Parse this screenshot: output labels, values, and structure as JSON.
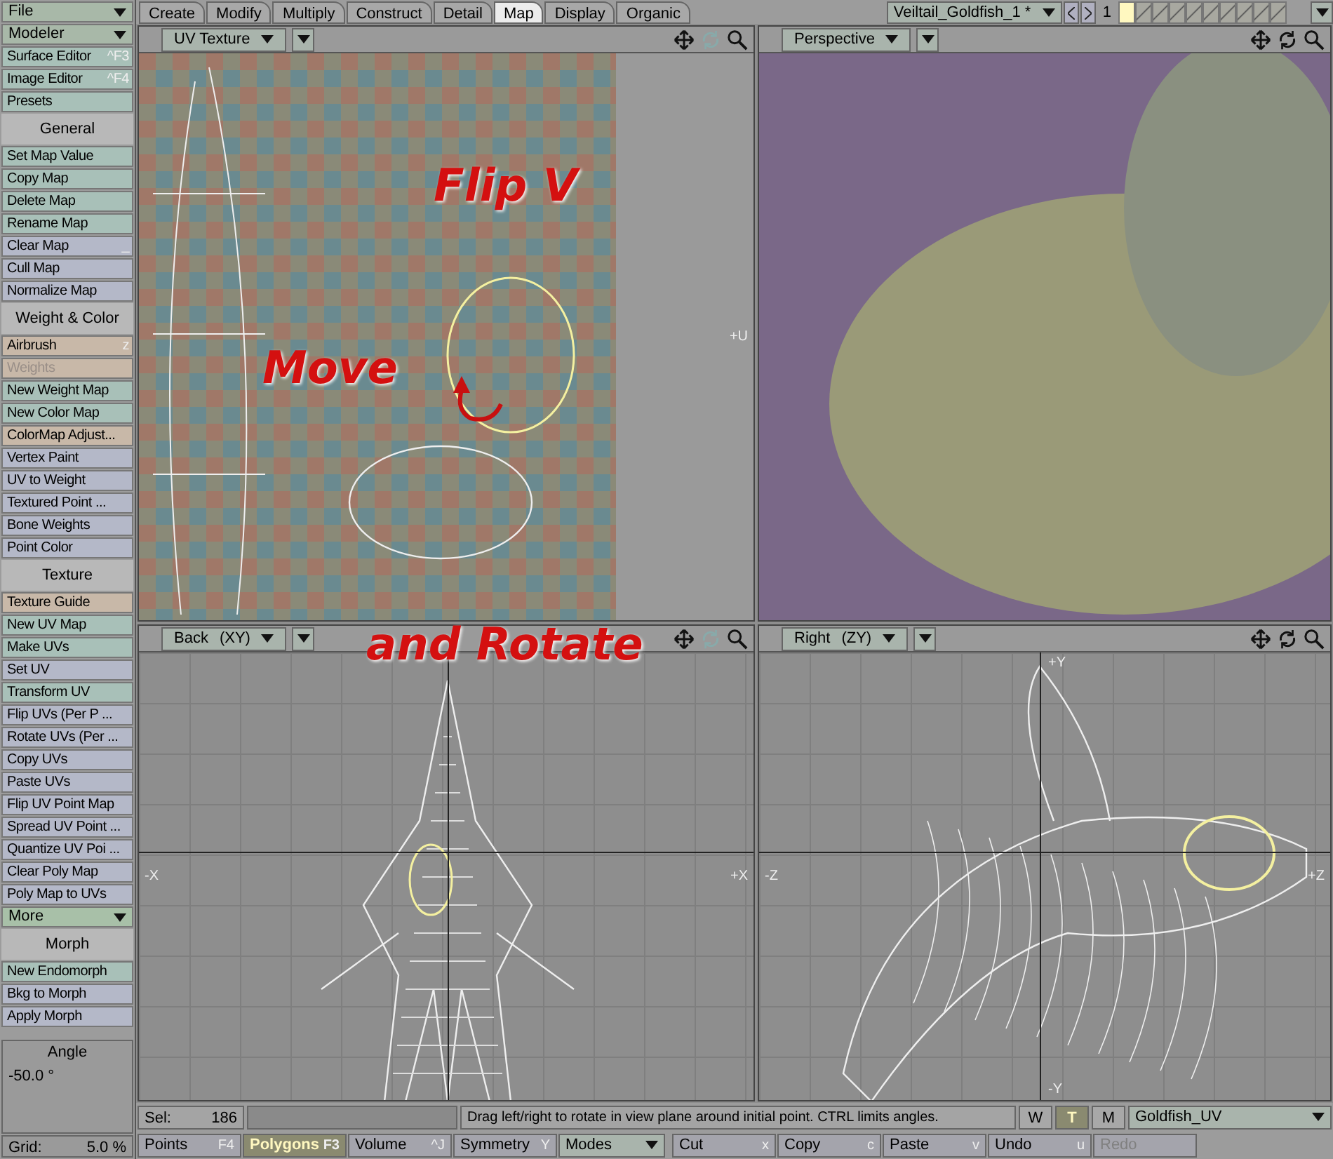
{
  "top_menu": [
    {
      "label": "File",
      "kind": "dropdown"
    },
    {
      "label": "Modeler",
      "kind": "dropdown"
    }
  ],
  "tabs": [
    {
      "label": "Create",
      "selected": false
    },
    {
      "label": "Modify",
      "selected": false
    },
    {
      "label": "Multiply",
      "selected": false
    },
    {
      "label": "Construct",
      "selected": false
    },
    {
      "label": "Detail",
      "selected": false
    },
    {
      "label": "Map",
      "selected": true
    },
    {
      "label": "Display",
      "selected": false
    },
    {
      "label": "Organic",
      "selected": false
    }
  ],
  "object_selector": {
    "value": "Veiltail_Goldfish_1 *",
    "layer_number": "1",
    "layers": [
      {
        "selected": true
      },
      {
        "selected": false
      },
      {
        "selected": false
      },
      {
        "selected": false
      },
      {
        "selected": false
      },
      {
        "selected": false
      },
      {
        "selected": false
      },
      {
        "selected": false
      },
      {
        "selected": false
      },
      {
        "selected": false
      }
    ]
  },
  "sidebar": {
    "items": [
      {
        "kind": "button",
        "label": "Surface Editor",
        "shortcut": "^F3",
        "color": "#a8c0b8",
        "disabled": false
      },
      {
        "kind": "button",
        "label": "Image Editor",
        "shortcut": "^F4",
        "color": "#a8c0b8",
        "disabled": false
      },
      {
        "kind": "button",
        "label": "Presets",
        "color": "#a8c0b8",
        "disabled": false
      },
      {
        "kind": "header",
        "label": "General"
      },
      {
        "kind": "button",
        "label": "Set Map Value",
        "color": "#a8c0b8",
        "disabled": false
      },
      {
        "kind": "button",
        "label": "Copy Map",
        "color": "#a8c0b8",
        "disabled": false
      },
      {
        "kind": "button",
        "label": "Delete Map",
        "color": "#a8c0b8",
        "disabled": false
      },
      {
        "kind": "button",
        "label": "Rename Map",
        "color": "#a8c0b8",
        "disabled": false
      },
      {
        "kind": "button",
        "label": "Clear Map",
        "shortcut": "_",
        "color": "#b4b8c8",
        "disabled": false
      },
      {
        "kind": "button",
        "label": "Cull Map",
        "color": "#b4b8c8",
        "disabled": false
      },
      {
        "kind": "button",
        "label": "Normalize Map",
        "color": "#b4b8c8",
        "disabled": false
      },
      {
        "kind": "header",
        "label": "Weight & Color"
      },
      {
        "kind": "button",
        "label": "Airbrush",
        "shortcut": "z",
        "color": "#c8b8a8",
        "disabled": false
      },
      {
        "kind": "button",
        "label": "Weights",
        "color": "#c8b8a8",
        "disabled": true
      },
      {
        "kind": "button",
        "label": "New Weight Map",
        "color": "#a8c0b8",
        "disabled": false
      },
      {
        "kind": "button",
        "label": "New Color Map",
        "color": "#a8c0b8",
        "disabled": false
      },
      {
        "kind": "button",
        "label": "ColorMap Adjust...",
        "color": "#c8b8a8",
        "disabled": false
      },
      {
        "kind": "button",
        "label": "Vertex Paint",
        "color": "#b4b8c8",
        "disabled": false
      },
      {
        "kind": "button",
        "label": "UV to Weight",
        "color": "#b4b8c8",
        "disabled": false
      },
      {
        "kind": "button",
        "label": "Textured Point ...",
        "color": "#b4b8c8",
        "disabled": false
      },
      {
        "kind": "button",
        "label": "Bone Weights",
        "color": "#b4b8c8",
        "disabled": false
      },
      {
        "kind": "button",
        "label": "Point Color",
        "color": "#b4b8c8",
        "disabled": false
      },
      {
        "kind": "header",
        "label": "Texture"
      },
      {
        "kind": "button",
        "label": "Texture Guide",
        "color": "#c8b8a8",
        "disabled": false
      },
      {
        "kind": "button",
        "label": "New UV Map",
        "color": "#a8c0b8",
        "disabled": false
      },
      {
        "kind": "button",
        "label": "Make UVs",
        "color": "#a8c0b8",
        "disabled": false
      },
      {
        "kind": "button",
        "label": "Set UV",
        "color": "#b4b8c8",
        "disabled": false
      },
      {
        "kind": "button",
        "label": "Transform UV",
        "color": "#a8c0b8",
        "disabled": false
      },
      {
        "kind": "button",
        "label": "Flip UVs (Per P ...",
        "color": "#b4b8c8",
        "disabled": false
      },
      {
        "kind": "button",
        "label": "Rotate UVs (Per ...",
        "color": "#b4b8c8",
        "disabled": false
      },
      {
        "kind": "button",
        "label": "Copy UVs",
        "color": "#b4b8c8",
        "disabled": false
      },
      {
        "kind": "button",
        "label": "Paste UVs",
        "color": "#b4b8c8",
        "disabled": false
      },
      {
        "kind": "button",
        "label": "Flip UV Point Map",
        "color": "#b4b8c8",
        "disabled": false
      },
      {
        "kind": "button",
        "label": "Spread UV Point ...",
        "color": "#b4b8c8",
        "disabled": false
      },
      {
        "kind": "button",
        "label": "Quantize UV Poi ...",
        "color": "#b4b8c8",
        "disabled": false
      },
      {
        "kind": "button",
        "label": "Clear Poly Map",
        "color": "#b4b8c8",
        "disabled": false
      },
      {
        "kind": "button",
        "label": "Poly Map to UVs",
        "color": "#b4b8c8",
        "disabled": false
      },
      {
        "kind": "dropdown",
        "label": "More",
        "color": "#a8c0a8"
      },
      {
        "kind": "header",
        "label": "Morph"
      },
      {
        "kind": "button",
        "label": "New Endomorph",
        "color": "#a8c0b8",
        "disabled": false
      },
      {
        "kind": "button",
        "label": "Bkg to Morph",
        "color": "#b4b8c8",
        "disabled": false
      },
      {
        "kind": "button",
        "label": "Apply Morph",
        "color": "#b4b8c8",
        "disabled": false
      }
    ],
    "angle": {
      "label": "Angle",
      "value": "-50.0 °"
    },
    "grid": {
      "label": "Grid:",
      "value": "5.0 %"
    }
  },
  "viewports": [
    {
      "kind": "uv",
      "view": "UV Texture",
      "axes": [
        "+U"
      ],
      "annotations": [
        "Flip V",
        "Move"
      ]
    },
    {
      "kind": "render",
      "view": "Perspective"
    },
    {
      "kind": "back",
      "view": "Back",
      "plane": "(XY)",
      "axes": [
        "-X",
        "+X"
      ],
      "annotations": [
        "and Rotate"
      ]
    },
    {
      "kind": "right",
      "view": "Right",
      "plane": "(ZY)",
      "axes": [
        "+Y",
        "-Z",
        "+Z",
        "-Y"
      ]
    }
  ],
  "status_bar": {
    "sel_label": "Sel:",
    "sel_value": "186",
    "message": "Drag left/right to rotate in view plane around initial point. CTRL limits angles.",
    "modes": [
      {
        "label": "W",
        "selected": false
      },
      {
        "label": "T",
        "selected": true
      },
      {
        "label": "M",
        "selected": false
      }
    ],
    "map": "Goldfish_UV"
  },
  "toolbar": [
    {
      "kind": "button",
      "label": "Points",
      "shortcut": "F4",
      "selected": false,
      "disabled": false
    },
    {
      "kind": "button",
      "label": "Polygons",
      "shortcut": "F3",
      "selected": true,
      "disabled": false
    },
    {
      "kind": "button",
      "label": "Volume",
      "shortcut": "^J",
      "selected": false,
      "disabled": false
    },
    {
      "kind": "button",
      "label": "Symmetry",
      "shortcut": "Y",
      "selected": false,
      "disabled": false
    },
    {
      "kind": "dropdown",
      "label": "Modes"
    },
    {
      "kind": "button",
      "label": "Cut",
      "shortcut": "x",
      "selected": false,
      "disabled": false
    },
    {
      "kind": "button",
      "label": "Copy",
      "shortcut": "c",
      "selected": false,
      "disabled": false
    },
    {
      "kind": "button",
      "label": "Paste",
      "shortcut": "v",
      "selected": false,
      "disabled": false
    },
    {
      "kind": "button",
      "label": "Undo",
      "shortcut": "u",
      "selected": false,
      "disabled": false
    },
    {
      "kind": "button",
      "label": "Redo",
      "selected": false,
      "disabled": true
    }
  ]
}
